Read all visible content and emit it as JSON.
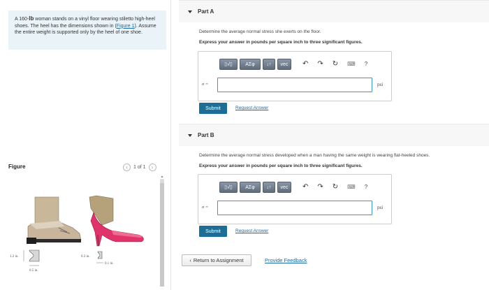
{
  "problem": {
    "text_1": "A 160-",
    "lb": "lb",
    "text_2": " woman stands on a vinyl floor wearing stiletto high-heel shoes. The heel has the dimensions shown in (",
    "figure_link": "Figure 1",
    "text_3": "). Assume the entire weight is supported only by the heel of one shoe."
  },
  "figure": {
    "title": "Figure",
    "pager": "1 of 1",
    "prev_glyph": "‹",
    "next_glyph": "›",
    "dims": {
      "d1": "1.2 in.",
      "d2": "0.5 in.",
      "d3": "0.3 in.",
      "d4": "0.1 in."
    }
  },
  "parts": [
    {
      "title": "Part A",
      "question": "Determine the average normal stress she exerts on the floor.",
      "instruction": "Express your answer in pounds per square inch to three significant figures.",
      "variable": "σ =",
      "value": "",
      "unit": "psi",
      "submit": "Submit",
      "request": "Request Answer"
    },
    {
      "title": "Part B",
      "question": "Determine the average normal stress developed when a man having the same weight is wearing flat-heeled shoes.",
      "instruction": "Express your answer in pounds per square inch to three significant figures.",
      "variable": "σ =",
      "value": "",
      "unit": "psi",
      "submit": "Submit",
      "request": "Request Answer"
    }
  ],
  "toolbar": {
    "templates": "▯√▯",
    "symbols": "ΑΣφ",
    "arrows": "↓↑",
    "vec": "vec",
    "undo": "↶",
    "redo": "↷",
    "reset": "↻",
    "keyboard": "⌨",
    "help": "?"
  },
  "footer": {
    "return": "Return to Assignment",
    "return_glyph": "‹",
    "feedback": "Provide Feedback"
  },
  "colors": {
    "link": "#1a6aa5",
    "submit": "#1c6e97",
    "problem_bg": "#e9f3f8",
    "input_border": "#2f9ec6",
    "heel_pink": "#e0336b"
  }
}
